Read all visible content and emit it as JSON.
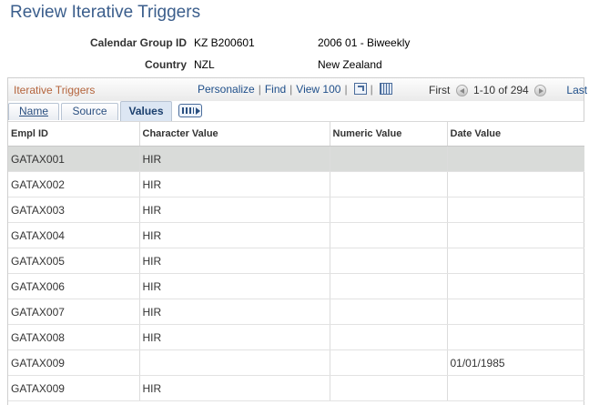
{
  "page": {
    "title": "Review Iterative Triggers"
  },
  "header": {
    "calendar_group_label": "Calendar Group ID",
    "calendar_group_id": "KZ B200601",
    "calendar_group_desc": "2006 01 - Biweekly",
    "country_label": "Country",
    "country_code": "NZL",
    "country_name": "New Zealand"
  },
  "grid": {
    "title": "Iterative Triggers",
    "nav": {
      "personalize": "Personalize",
      "find": "Find",
      "view_all": "View 100",
      "zoom_icon": "zoom-icon",
      "download_icon": "spreadsheet-icon"
    },
    "pager": {
      "first": "First",
      "range": "1-10 of 294",
      "last": "Last"
    },
    "tabs": [
      {
        "label": "Name"
      },
      {
        "label": "Source"
      },
      {
        "label": "Values"
      }
    ],
    "show_all_columns_icon": "show-all-columns-icon",
    "columns": [
      "Empl ID",
      "Character Value",
      "Numeric Value",
      "Date Value"
    ],
    "rows": [
      {
        "empl_id": "GATAX001",
        "char_value": "HIR",
        "num_value": "",
        "date_value": ""
      },
      {
        "empl_id": "GATAX002",
        "char_value": "HIR",
        "num_value": "",
        "date_value": ""
      },
      {
        "empl_id": "GATAX003",
        "char_value": "HIR",
        "num_value": "",
        "date_value": ""
      },
      {
        "empl_id": "GATAX004",
        "char_value": "HIR",
        "num_value": "",
        "date_value": ""
      },
      {
        "empl_id": "GATAX005",
        "char_value": "HIR",
        "num_value": "",
        "date_value": ""
      },
      {
        "empl_id": "GATAX006",
        "char_value": "HIR",
        "num_value": "",
        "date_value": ""
      },
      {
        "empl_id": "GATAX007",
        "char_value": "HIR",
        "num_value": "",
        "date_value": ""
      },
      {
        "empl_id": "GATAX008",
        "char_value": "HIR",
        "num_value": "",
        "date_value": ""
      },
      {
        "empl_id": "GATAX009",
        "char_value": "",
        "num_value": "",
        "date_value": "01/01/1985"
      },
      {
        "empl_id": "GATAX009",
        "char_value": "HIR",
        "num_value": "",
        "date_value": ""
      }
    ]
  }
}
